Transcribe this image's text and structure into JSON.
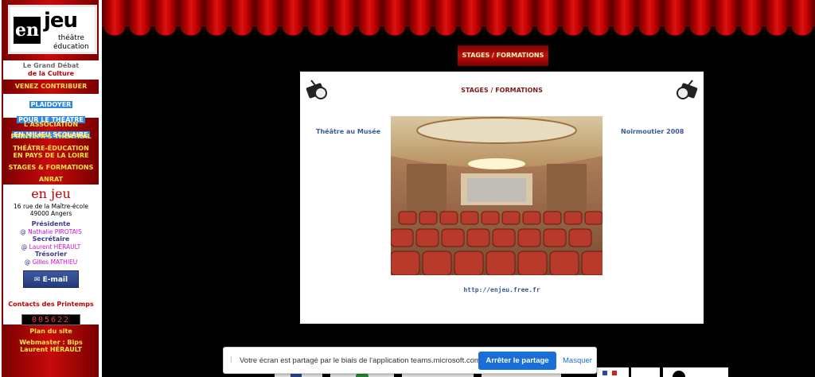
{
  "logo": {
    "en": "en",
    "jeu": "jeu",
    "line1": "théâtre",
    "line2": "éducation"
  },
  "debat": {
    "line1": "Le Grand Débat",
    "line2": "de la Culture"
  },
  "nav": {
    "venez": "VENEZ CONTRIBUER",
    "plaidoyer": [
      "PLAIDOYER",
      "POUR LE THÉÂTRE",
      "EN MILIEU SCOLAIRE"
    ],
    "association": "L'ASSOCIATION",
    "printemps": "PRINTEMPS THÉÂTRAL",
    "theatre_education_1": "THÉÂTRE-ÉDUCATION",
    "theatre_education_2": "EN PAYS DE LA LOIRE",
    "stages": "STAGES & FORMATIONS",
    "anrat": "ANRAT"
  },
  "address": {
    "title": "en jeu",
    "street": "16 rue de la Maître-école",
    "city": "49000 Angers",
    "president_role": "Présidente",
    "president": "Nathalie PIROTAIS",
    "secretary_role": "Secrétaire",
    "secretary": "Laurent HÉRAULT",
    "treasurer_role": "Trésorier",
    "treasurer": "Gilles MATHIEU",
    "at": "@",
    "email_label": "E-mail",
    "contacts": "Contacts des Printemps",
    "counter": "005622"
  },
  "footer": {
    "plan": "Plan du site",
    "webmaster": "Webmaster : Bips",
    "webmaster_name": "Laurent HÉRAULT"
  },
  "top_tab": "STAGES / FORMATIONS",
  "panel": {
    "title": "STAGES / FORMATIONS",
    "left_link": "Théâtre au Musée",
    "right_link": "Noirmoutier 2008",
    "url": "http://enjeu.free.fr"
  },
  "share_bar": {
    "message": "Votre écran est partagé par le biais de l'application teams.microsoft.com.",
    "stop_label": "Arrêter le partage",
    "hide_label": "Masquer"
  },
  "colors": {
    "sidebar_red": "#c80a0a",
    "nav_yellow": "#ffe14a",
    "link_blue": "#3a5a98",
    "teams_blue": "#1a6ed8"
  }
}
